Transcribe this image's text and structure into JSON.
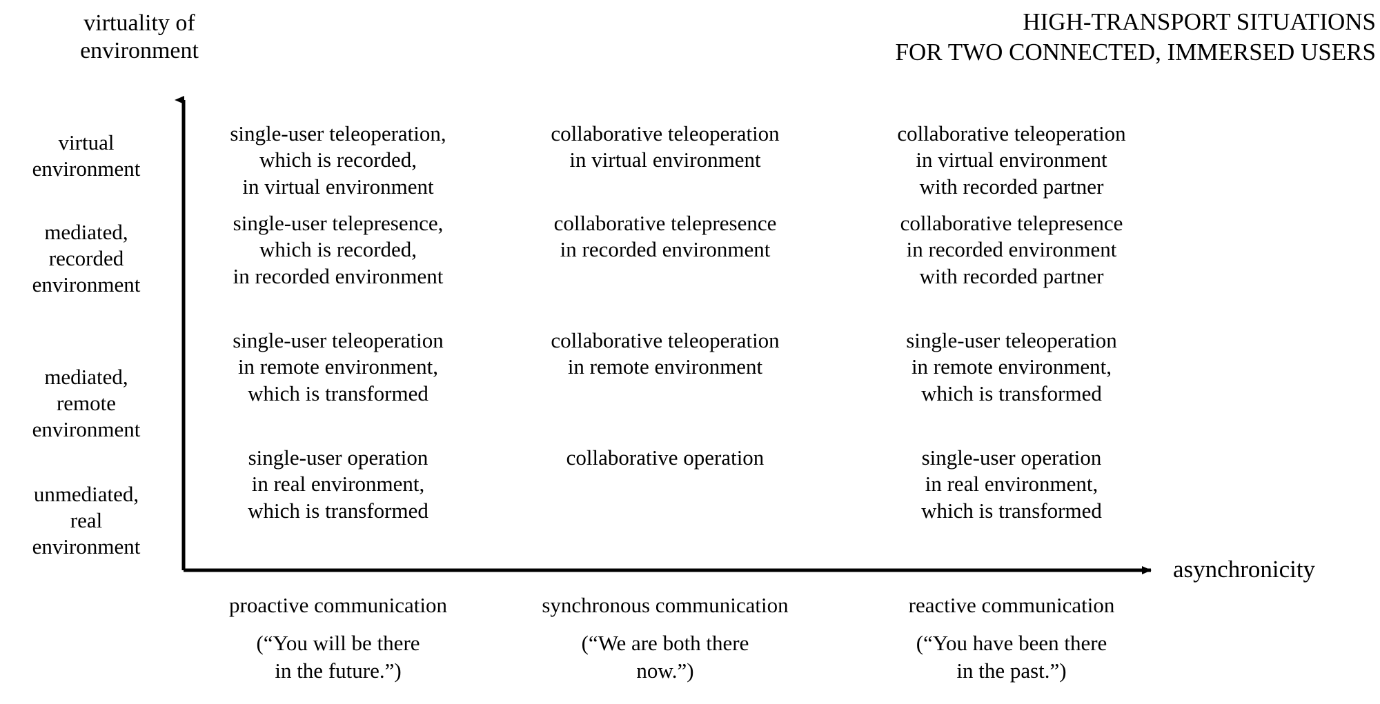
{
  "title": "HIGH-TRANSPORT SITUATIONS\nFOR TWO CONNECTED, IMMERSED USERS",
  "axes": {
    "y_caption": "virtuality of\nenvironment",
    "x_caption": "asynchronicity",
    "line_color": "#000000"
  },
  "rows": [
    {
      "label": "virtual\nenvironment"
    },
    {
      "label": "mediated,\nrecorded\nenvironment"
    },
    {
      "label": "mediated,\nremote\nenvironment"
    },
    {
      "label": "unmediated,\nreal\nenvironment"
    }
  ],
  "columns": [
    {
      "label": "proactive communication",
      "quote": "(“You will be there\nin the future.”)"
    },
    {
      "label": "synchronous communication",
      "quote": "(“We are both there\nnow.”)"
    },
    {
      "label": "reactive communication",
      "quote": "(“You have been there\nin the past.”)"
    }
  ],
  "cells": [
    [
      "single-user teleoperation,\nwhich is recorded,\nin virtual environment",
      "collaborative teleoperation\nin virtual environment",
      "collaborative teleoperation\nin virtual environment\nwith recorded partner"
    ],
    [
      "single-user telepresence,\nwhich is recorded,\nin recorded environment",
      "collaborative telepresence\nin recorded environment",
      "collaborative telepresence\nin recorded environment\nwith recorded partner"
    ],
    [
      "single-user teleoperation\nin remote environment,\nwhich is transformed",
      "collaborative teleoperation\nin remote environment",
      "single-user teleoperation\nin remote environment,\nwhich is transformed"
    ],
    [
      "single-user operation\nin real environment,\nwhich is transformed",
      "collaborative operation",
      "single-user operation\nin real environment,\nwhich is transformed"
    ]
  ],
  "chart_data": {
    "type": "table",
    "title": "HIGH-TRANSPORT SITUATIONS FOR TWO CONNECTED, IMMERSED USERS",
    "xlabel": "asynchronicity",
    "ylabel": "virtuality of environment",
    "categories": [
      "proactive communication",
      "synchronous communication",
      "reactive communication"
    ],
    "row_categories": [
      "virtual environment",
      "mediated, recorded environment",
      "mediated, remote environment",
      "unmediated, real environment"
    ],
    "grid": false,
    "legend": "none"
  }
}
